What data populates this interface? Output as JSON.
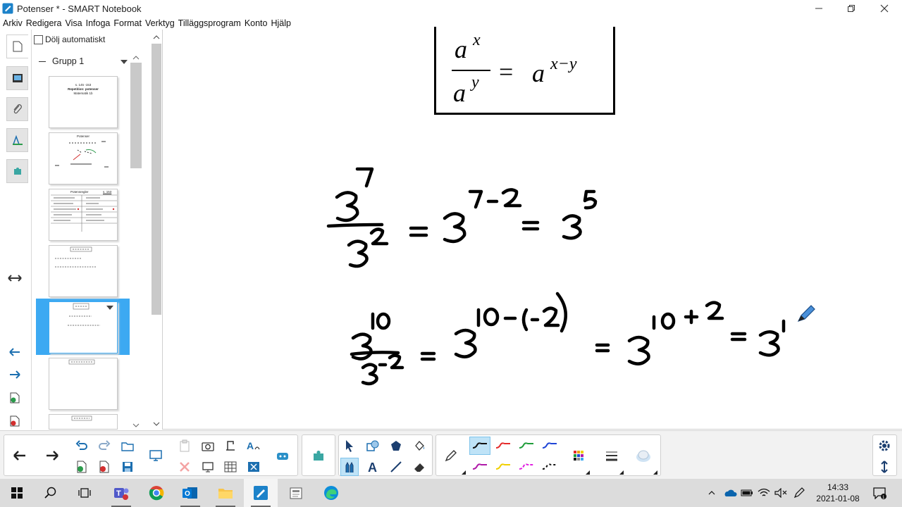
{
  "window": {
    "title": "Potenser * - SMART Notebook"
  },
  "menu": [
    "Arkiv",
    "Redigera",
    "Visa",
    "Infoga",
    "Format",
    "Verktyg",
    "Tilläggsprogram",
    "Konto",
    "Hjälp"
  ],
  "pages_panel": {
    "hide_label": "Dölj automatiskt",
    "group_label": "Grupp 1",
    "pages": [
      {
        "num": "1",
        "lines": [
          "s. 145 -153",
          "Repetition: potenser",
          "Matematik 1b"
        ]
      },
      {
        "num": "2",
        "lines": [
          "Potenser"
        ]
      },
      {
        "num": "3",
        "lines": [
          "Potensregler",
          "s. 153"
        ]
      },
      {
        "num": "4",
        "lines": []
      },
      {
        "num": "5",
        "lines": []
      },
      {
        "num": "6",
        "lines": []
      },
      {
        "num": "7",
        "lines": []
      }
    ],
    "selected": "5"
  },
  "formula_box": {
    "base": "a",
    "num_exp": "x",
    "den_exp": "y",
    "equals": "=",
    "result_exp": "x−y"
  },
  "handwriting": {
    "line1": {
      "base": "3",
      "num_exp": "7",
      "den_exp": "2",
      "step_exp": "7-2",
      "result_exp": "5"
    },
    "line2": {
      "num_exp": "10",
      "den_exp": "-2",
      "step_exp": "10-(-2)",
      "step2_exp": "10+2",
      "partial": "1"
    }
  },
  "taskbar": {
    "time": "14:33",
    "date": "2021-01-08"
  },
  "colors": {
    "accent": "#3ca9f2",
    "pen_red": "#e52b2b",
    "pen_green": "#1f9d3a",
    "pen_blue": "#1f45d6",
    "pen_purple": "#b01aa8",
    "pen_yellow": "#f0d000",
    "pen_magenta": "#e020e0"
  }
}
